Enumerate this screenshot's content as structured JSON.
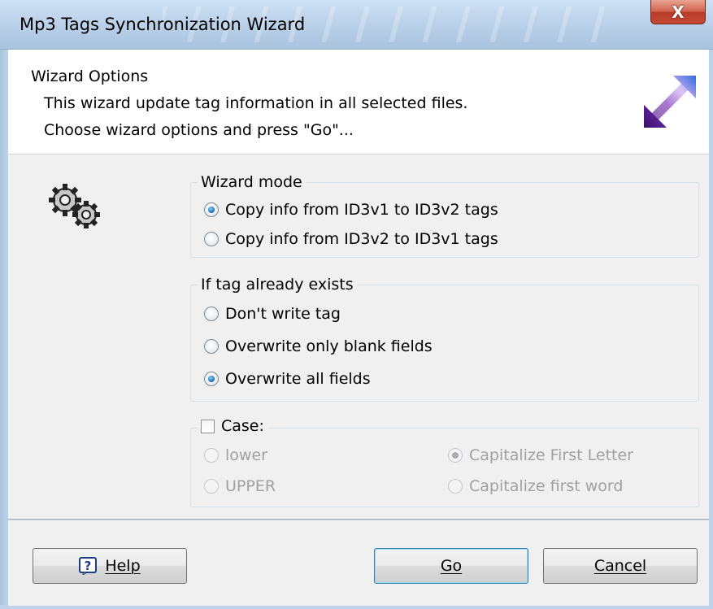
{
  "window": {
    "title": "Mp3 Tags Synchronization Wizard",
    "close_symbol": "X"
  },
  "header": {
    "title": "Wizard Options",
    "line1": "This wizard update tag information in all selected files.",
    "line2": "Choose wizard options and press \"Go\"...",
    "icon": "sync-arrows-icon"
  },
  "body_icon": "gears-icon",
  "wizard_mode": {
    "legend": "Wizard mode",
    "options": [
      {
        "label": "Copy info from ID3v1 to ID3v2 tags",
        "checked": true
      },
      {
        "label": "Copy info from ID3v2 to ID3v1 tags",
        "checked": false
      }
    ]
  },
  "if_exists": {
    "legend": "If tag already exists",
    "options": [
      {
        "label": "Don't write tag",
        "checked": false
      },
      {
        "label": "Overwrite only blank fields",
        "checked": false
      },
      {
        "label": "Overwrite all fields",
        "checked": true
      }
    ]
  },
  "case": {
    "legend": "Case:",
    "enabled": false,
    "options": [
      {
        "label": "lower",
        "checked": false
      },
      {
        "label": "UPPER",
        "checked": false
      },
      {
        "label": "Capitalize First Letter",
        "checked": true
      },
      {
        "label": "Capitalize first word",
        "checked": false
      }
    ]
  },
  "buttons": {
    "help": "Help",
    "go": "Go",
    "cancel": "Cancel"
  },
  "colors": {
    "accent": "#2572b8",
    "disabled_text": "#a0a0a0"
  }
}
